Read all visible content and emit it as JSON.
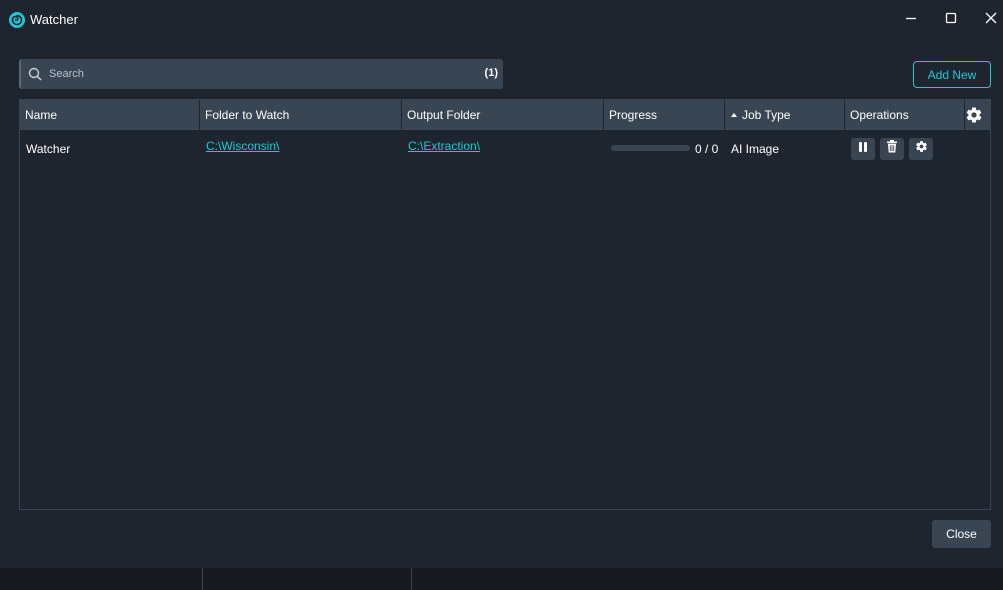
{
  "window": {
    "title": "Watcher",
    "icons": {
      "app": "swirl-icon",
      "minimize": "minimize-icon",
      "maximize": "maximize-icon",
      "close": "close-icon"
    }
  },
  "search": {
    "placeholder": "Search",
    "value": "",
    "count": "(1)",
    "icon": "search-icon"
  },
  "toolbar": {
    "add_new_label": "Add New"
  },
  "table": {
    "columns": [
      "Name",
      "Folder to Watch",
      "Output Folder",
      "Progress",
      "Job Type",
      "Operations"
    ],
    "sorted_column": "Job Type",
    "sort_direction": "ascending",
    "settings_icon": "gear-icon",
    "rows": [
      {
        "name": "Watcher",
        "folder_to_watch": "C:\\Wisconsin\\",
        "output_folder": "C:\\Extraction\\",
        "progress_text": "0 / 0",
        "progress_fraction": 0,
        "job_type": "AI Image",
        "operations": [
          "pause-icon",
          "trash-icon",
          "gear-icon"
        ]
      }
    ]
  },
  "footer": {
    "close_label": "Close"
  },
  "colors": {
    "background": "#1f252e",
    "header": "#3a4553",
    "accent": "#1ec8d8",
    "text": "#ffffff"
  }
}
